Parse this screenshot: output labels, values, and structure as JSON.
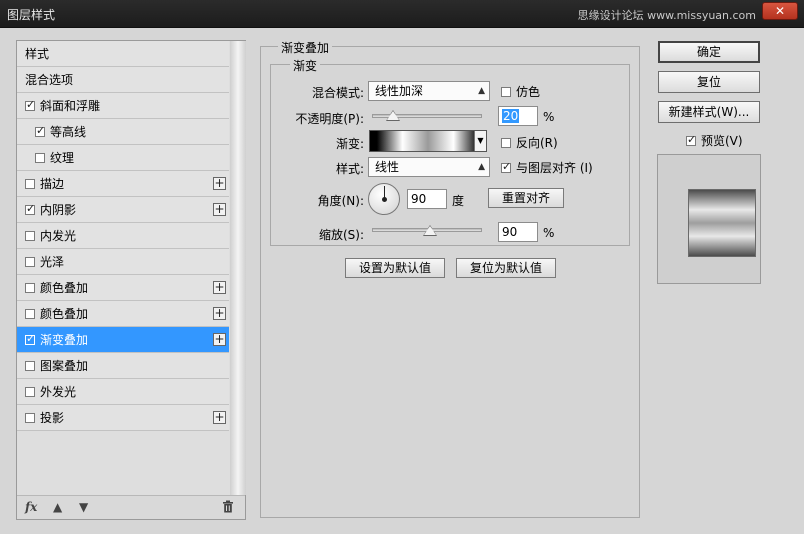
{
  "window": {
    "title": "图层样式",
    "watermark": "思缘设计论坛  www.missyuan.com",
    "close_label": "✕"
  },
  "left_panel": {
    "items": [
      {
        "label": "样式",
        "checkbox": false,
        "checked": false,
        "plus": false,
        "sub": false,
        "selected": false
      },
      {
        "label": "混合选项",
        "checkbox": false,
        "checked": false,
        "plus": false,
        "sub": false,
        "selected": false
      },
      {
        "label": "斜面和浮雕",
        "checkbox": true,
        "checked": true,
        "plus": false,
        "sub": false,
        "selected": false
      },
      {
        "label": "等高线",
        "checkbox": true,
        "checked": true,
        "plus": false,
        "sub": true,
        "selected": false
      },
      {
        "label": "纹理",
        "checkbox": true,
        "checked": false,
        "plus": false,
        "sub": true,
        "selected": false
      },
      {
        "label": "描边",
        "checkbox": true,
        "checked": false,
        "plus": true,
        "sub": false,
        "selected": false
      },
      {
        "label": "内阴影",
        "checkbox": true,
        "checked": true,
        "plus": true,
        "sub": false,
        "selected": false
      },
      {
        "label": "内发光",
        "checkbox": true,
        "checked": false,
        "plus": false,
        "sub": false,
        "selected": false
      },
      {
        "label": "光泽",
        "checkbox": true,
        "checked": false,
        "plus": false,
        "sub": false,
        "selected": false
      },
      {
        "label": "颜色叠加",
        "checkbox": true,
        "checked": false,
        "plus": true,
        "sub": false,
        "selected": false
      },
      {
        "label": "颜色叠加",
        "checkbox": true,
        "checked": false,
        "plus": true,
        "sub": false,
        "selected": false
      },
      {
        "label": "渐变叠加",
        "checkbox": true,
        "checked": true,
        "plus": true,
        "sub": false,
        "selected": true
      },
      {
        "label": "图案叠加",
        "checkbox": true,
        "checked": false,
        "plus": false,
        "sub": false,
        "selected": false
      },
      {
        "label": "外发光",
        "checkbox": true,
        "checked": false,
        "plus": false,
        "sub": false,
        "selected": false
      },
      {
        "label": "投影",
        "checkbox": true,
        "checked": false,
        "plus": true,
        "sub": false,
        "selected": false
      }
    ],
    "footer": {
      "fx_label": "fx",
      "up_icon": "arrow-up-icon",
      "down_icon": "arrow-down-icon",
      "trash_icon": "trash-icon"
    }
  },
  "gradient_overlay": {
    "group_title": "渐变叠加",
    "inner_title": "渐变",
    "blend_mode_label": "混合模式:",
    "blend_mode_value": "线性加深",
    "dither_label": "仿色",
    "dither_checked": false,
    "opacity_label": "不透明度(P):",
    "opacity_value": "20",
    "opacity_unit": "%",
    "gradient_label": "渐变:",
    "reverse_label": "反向(R)",
    "reverse_checked": false,
    "style_label": "样式:",
    "style_value": "线性",
    "align_label": "与图层对齐 (I)",
    "align_checked": true,
    "angle_label": "角度(N):",
    "angle_value": "90",
    "angle_unit": "度",
    "reset_align_label": "重置对齐",
    "scale_label": "缩放(S):",
    "scale_value": "90",
    "scale_unit": "%",
    "set_default_label": "设置为默认值",
    "reset_default_label": "复位为默认值"
  },
  "right_panel": {
    "ok_label": "确定",
    "reset_label": "复位",
    "new_style_label": "新建样式(W)...",
    "preview_label": "预览(V)",
    "preview_checked": true
  }
}
